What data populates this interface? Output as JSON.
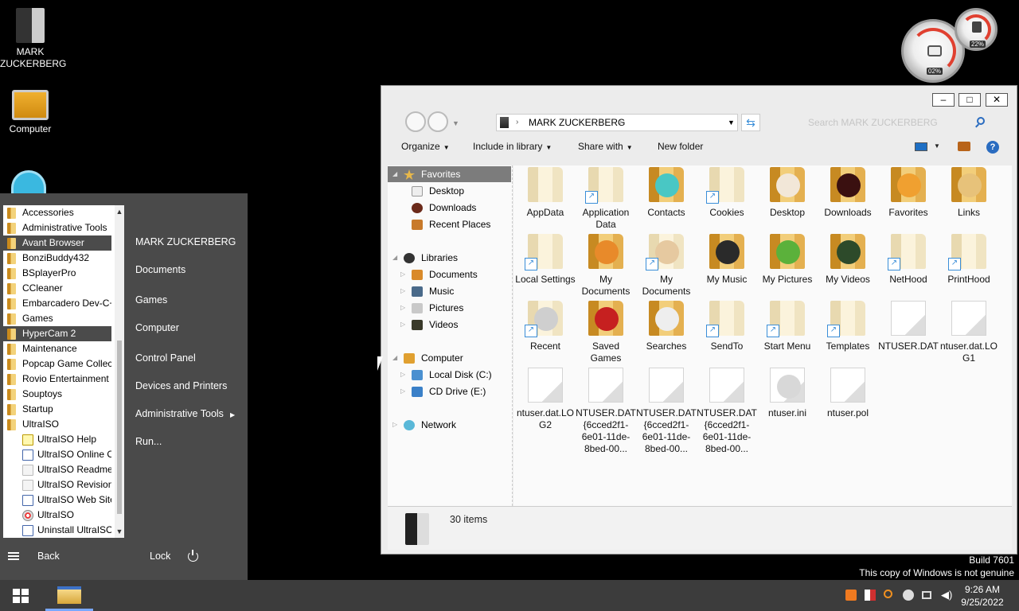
{
  "desktop": {
    "icons": [
      {
        "label": "MARK\nZUCKERBERG",
        "icon": "user-folder-icon"
      },
      {
        "label": "Computer",
        "icon": "computer-icon"
      }
    ]
  },
  "gadget": {
    "cpu_pct": "02%",
    "mem_pct": "22%"
  },
  "start_menu": {
    "programs": [
      {
        "label": "Accessories",
        "hl": false,
        "sub": false,
        "icon": "folder"
      },
      {
        "label": "Administrative Tools",
        "hl": false,
        "sub": false,
        "icon": "folder"
      },
      {
        "label": "Avant Browser",
        "hl": true,
        "sub": false,
        "icon": "folder"
      },
      {
        "label": "BonziBuddy432",
        "hl": false,
        "sub": false,
        "icon": "folder"
      },
      {
        "label": "BSplayerPro",
        "hl": false,
        "sub": false,
        "icon": "folder"
      },
      {
        "label": "CCleaner",
        "hl": false,
        "sub": false,
        "icon": "folder"
      },
      {
        "label": "Embarcadero Dev-C++",
        "hl": false,
        "sub": false,
        "icon": "folder"
      },
      {
        "label": "Games",
        "hl": false,
        "sub": false,
        "icon": "folder"
      },
      {
        "label": "HyperCam 2",
        "hl": true,
        "sub": false,
        "icon": "folder"
      },
      {
        "label": "Maintenance",
        "hl": false,
        "sub": false,
        "icon": "folder"
      },
      {
        "label": "Popcap Game Collection",
        "hl": false,
        "sub": false,
        "icon": "folder"
      },
      {
        "label": "Rovio Entertainment",
        "hl": false,
        "sub": false,
        "icon": "folder"
      },
      {
        "label": "Souptoys",
        "hl": false,
        "sub": false,
        "icon": "folder"
      },
      {
        "label": "Startup",
        "hl": false,
        "sub": false,
        "icon": "folder"
      },
      {
        "label": "UltraISO",
        "hl": false,
        "sub": false,
        "icon": "folder"
      },
      {
        "label": "UltraISO Help",
        "hl": false,
        "sub": true,
        "icon": "help"
      },
      {
        "label": "UltraISO Online Order",
        "hl": false,
        "sub": true,
        "icon": "ultra"
      },
      {
        "label": "UltraISO Readme",
        "hl": false,
        "sub": true,
        "icon": "doc"
      },
      {
        "label": "UltraISO Revision History",
        "hl": false,
        "sub": true,
        "icon": "doc"
      },
      {
        "label": "UltraISO Web Site",
        "hl": false,
        "sub": true,
        "icon": "ultra"
      },
      {
        "label": "UltraISO",
        "hl": false,
        "sub": true,
        "icon": "disc"
      },
      {
        "label": "Uninstall UltraISO",
        "hl": false,
        "sub": true,
        "icon": "ultra"
      }
    ],
    "right_items": [
      {
        "label": "MARK ZUCKERBERG"
      },
      {
        "label": "Documents"
      },
      {
        "label": "Games"
      },
      {
        "label": "Computer"
      },
      {
        "label": "Control Panel"
      },
      {
        "label": "Devices and Printers"
      },
      {
        "label": "Administrative Tools"
      },
      {
        "label": "Run..."
      }
    ],
    "back": "Back",
    "lock": "Lock"
  },
  "explorer": {
    "address": "MARK ZUCKERBERG",
    "search_placeholder": "Search MARK ZUCKERBERG",
    "toolbar": {
      "organize": "Organize",
      "include": "Include in library",
      "share": "Share with",
      "new_folder": "New folder"
    },
    "nav": {
      "favorites": "Favorites",
      "desktop": "Desktop",
      "downloads": "Downloads",
      "recent": "Recent Places",
      "libraries": "Libraries",
      "documents": "Documents",
      "music": "Music",
      "pictures": "Pictures",
      "videos": "Videos",
      "computer": "Computer",
      "local_disk": "Local Disk (C:)",
      "cd_drive": "CD Drive (E:)",
      "network": "Network"
    },
    "files": [
      {
        "label": "AppData",
        "kind": "folder-light",
        "shortcut": false,
        "overlay": ""
      },
      {
        "label": "Application Data",
        "kind": "folder-light",
        "shortcut": true,
        "overlay": ""
      },
      {
        "label": "Contacts",
        "kind": "folder",
        "shortcut": false,
        "overlay": "#49c7c4"
      },
      {
        "label": "Cookies",
        "kind": "folder-light",
        "shortcut": true,
        "overlay": ""
      },
      {
        "label": "Desktop",
        "kind": "folder",
        "shortcut": false,
        "overlay": "#f2e7d8"
      },
      {
        "label": "Downloads",
        "kind": "folder",
        "shortcut": false,
        "overlay": "#3a1010"
      },
      {
        "label": "Favorites",
        "kind": "folder",
        "shortcut": false,
        "overlay": "#f0a030"
      },
      {
        "label": "Links",
        "kind": "folder",
        "shortcut": false,
        "overlay": "#e7c27a"
      },
      {
        "label": "Local Settings",
        "kind": "folder-light",
        "shortcut": true,
        "overlay": ""
      },
      {
        "label": "My Documents",
        "kind": "folder",
        "shortcut": false,
        "overlay": "#e88a2a"
      },
      {
        "label": "My Documents",
        "kind": "folder-light",
        "shortcut": true,
        "overlay": "#e6c9a0"
      },
      {
        "label": "My Music",
        "kind": "folder",
        "shortcut": false,
        "overlay": "#2a2a2a"
      },
      {
        "label": "My Pictures",
        "kind": "folder",
        "shortcut": false,
        "overlay": "#5bb13b"
      },
      {
        "label": "My Videos",
        "kind": "folder",
        "shortcut": false,
        "overlay": "#2d4a2a"
      },
      {
        "label": "NetHood",
        "kind": "folder-light",
        "shortcut": true,
        "overlay": ""
      },
      {
        "label": "PrintHood",
        "kind": "folder-light",
        "shortcut": true,
        "overlay": ""
      },
      {
        "label": "Recent",
        "kind": "folder-light",
        "shortcut": true,
        "overlay": "#cfcfcf"
      },
      {
        "label": "Saved Games",
        "kind": "folder",
        "shortcut": false,
        "overlay": "#c62020"
      },
      {
        "label": "Searches",
        "kind": "folder",
        "shortcut": false,
        "overlay": "#eeeeee"
      },
      {
        "label": "SendTo",
        "kind": "folder-light",
        "shortcut": true,
        "overlay": ""
      },
      {
        "label": "Start Menu",
        "kind": "folder-light",
        "shortcut": true,
        "overlay": ""
      },
      {
        "label": "Templates",
        "kind": "folder-light",
        "shortcut": true,
        "overlay": ""
      },
      {
        "label": "NTUSER.DAT",
        "kind": "file",
        "shortcut": false,
        "overlay": ""
      },
      {
        "label": "ntuser.dat.LOG1",
        "kind": "file",
        "shortcut": false,
        "overlay": ""
      },
      {
        "label": "ntuser.dat.LOG2",
        "kind": "file",
        "shortcut": false,
        "overlay": ""
      },
      {
        "label": "NTUSER.DAT{6cced2f1-6e01-11de-8bed-00...",
        "kind": "file",
        "shortcut": false,
        "overlay": ""
      },
      {
        "label": "NTUSER.DAT{6cced2f1-6e01-11de-8bed-00...",
        "kind": "file",
        "shortcut": false,
        "overlay": ""
      },
      {
        "label": "NTUSER.DAT{6cced2f1-6e01-11de-8bed-00...",
        "kind": "file",
        "shortcut": false,
        "overlay": ""
      },
      {
        "label": "ntuser.ini",
        "kind": "file",
        "shortcut": false,
        "overlay": "#d8d8d8"
      },
      {
        "label": "ntuser.pol",
        "kind": "file",
        "shortcut": false,
        "overlay": ""
      }
    ],
    "status": "30 items"
  },
  "watermark": {
    "line1": "Build 7601",
    "line2": "This copy of Windows is not genuine"
  },
  "taskbar": {
    "time": "9:26 AM",
    "date": "9/25/2022"
  }
}
